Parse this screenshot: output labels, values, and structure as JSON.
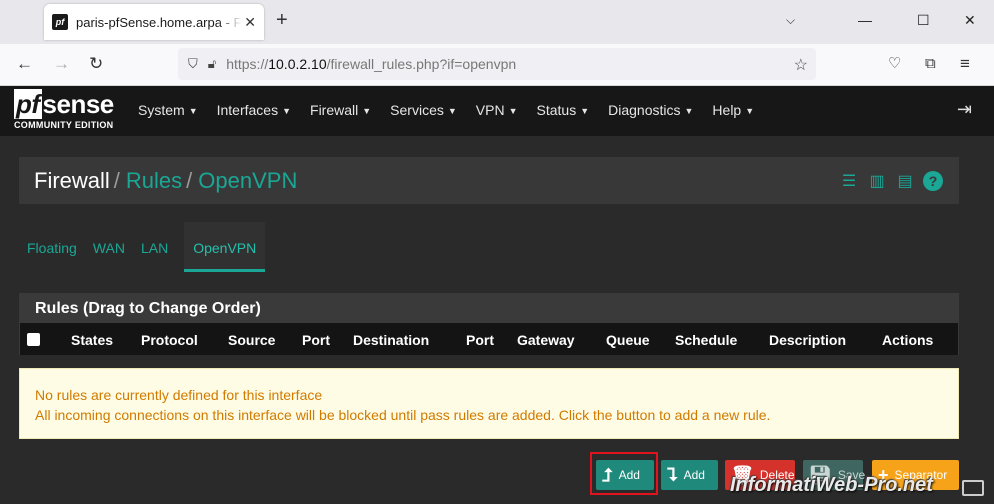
{
  "browser": {
    "tab_title": "paris-pfSense.home.arpa - Firewall: Rules: OpenVPN",
    "url_prefix": "https://",
    "url_host": "10.0.2.10",
    "url_path": "/firewall_rules.php?if=openvpn"
  },
  "logo": {
    "pf": "pf",
    "sense": "sense",
    "edition": "COMMUNITY EDITION"
  },
  "menu": [
    "System",
    "Interfaces",
    "Firewall",
    "Services",
    "VPN",
    "Status",
    "Diagnostics",
    "Help"
  ],
  "breadcrumb": {
    "root": "Firewall",
    "level2": "Rules",
    "level3": "OpenVPN"
  },
  "tabs": [
    "Floating",
    "WAN",
    "LAN",
    "OpenVPN"
  ],
  "rules_table": {
    "heading": "Rules (Drag to Change Order)",
    "columns": [
      "States",
      "Protocol",
      "Source",
      "Port",
      "Destination",
      "Port",
      "Gateway",
      "Queue",
      "Schedule",
      "Description",
      "Actions"
    ]
  },
  "notice": {
    "line1": "No rules are currently defined for this interface",
    "line2": "All incoming connections on this interface will be blocked until pass rules are added. Click the button to add a new rule."
  },
  "buttons": {
    "add_top": "Add",
    "add_bottom": "Add",
    "delete": "Delete",
    "save": "Save",
    "separator": "Separator"
  },
  "watermark": "InformatiWeb-Pro.net",
  "colors": {
    "accent": "#1aa796",
    "header": "#171717",
    "notice_text": "#d17a00",
    "highlight": "#e0141e"
  }
}
